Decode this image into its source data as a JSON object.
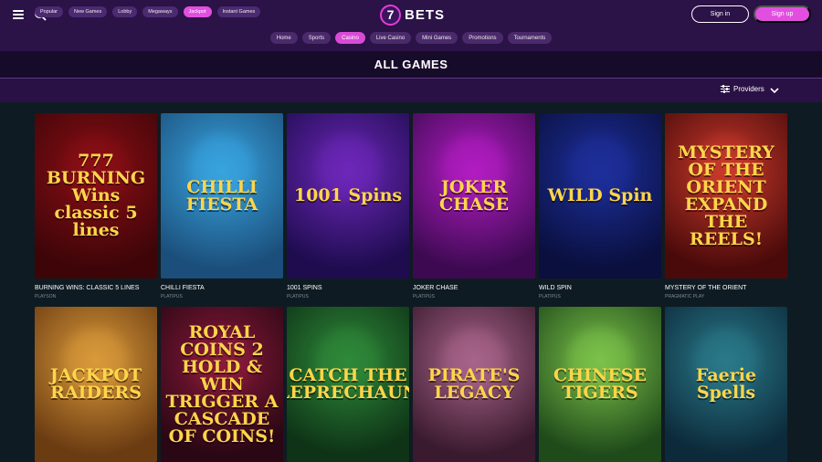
{
  "header": {
    "logo_number": "7",
    "logo_text": "BETS",
    "signin_label": "Sign in",
    "signup_label": "Sign up"
  },
  "nav": {
    "items": [
      "Home",
      "Sports",
      "Casino",
      "Live Casino",
      "Mini Games",
      "Promotions",
      "Tournaments"
    ],
    "active": "Casino"
  },
  "page_title": "ALL GAMES",
  "filters": {
    "items": [
      "Popular",
      "New Games",
      "Lobby",
      "Megaways",
      "Jackpot",
      "Instant Games"
    ],
    "active": "Jackpot",
    "providers_label": "Providers"
  },
  "games": [
    {
      "name": "BURNING WINS: CLASSIC 5 LINES",
      "provider": "PLAYSON",
      "thumb_text": "777 BURNING Wins classic 5 lines",
      "colors": [
        "#8b0f16",
        "#3d0508"
      ]
    },
    {
      "name": "CHILLI FIESTA",
      "provider": "PLATIPUS",
      "thumb_text": "CHILLI FIESTA",
      "colors": [
        "#38a4e0",
        "#1b4e7a"
      ]
    },
    {
      "name": "1001 SPINS",
      "provider": "PLATIPUS",
      "thumb_text": "1001 Spins",
      "colors": [
        "#6d27b9",
        "#1e0c4f"
      ]
    },
    {
      "name": "JOKER CHASE",
      "provider": "PLATIPUS",
      "thumb_text": "JOKER CHASE",
      "colors": [
        "#b21cc2",
        "#3d0a52"
      ]
    },
    {
      "name": "WILD SPIN",
      "provider": "PLATIPUS",
      "thumb_text": "WILD Spin",
      "colors": [
        "#1d2f9c",
        "#0a0f3d"
      ]
    },
    {
      "name": "MYSTERY OF THE ORIENT",
      "provider": "PRAGMATIC PLAY",
      "thumb_text": "MYSTERY OF THE ORIENT EXPAND THE REELS!",
      "colors": [
        "#c93a2c",
        "#4a0a0a"
      ]
    },
    {
      "name": "",
      "provider": "",
      "thumb_text": "JACKPOT RAIDERS",
      "colors": [
        "#d99a3a",
        "#6b3b12"
      ]
    },
    {
      "name": "",
      "provider": "",
      "thumb_text": "ROYAL COINS 2 HOLD & WIN TRIGGER A CASCADE OF COINS!",
      "colors": [
        "#8a1a3a",
        "#2a0714"
      ]
    },
    {
      "name": "",
      "provider": "",
      "thumb_text": "CATCH THE LEPRECHAUN",
      "colors": [
        "#2f8a3a",
        "#0e3316"
      ]
    },
    {
      "name": "",
      "provider": "",
      "thumb_text": "PIRATE'S LEGACY",
      "colors": [
        "#a8648a",
        "#3a1a2e"
      ]
    },
    {
      "name": "",
      "provider": "",
      "thumb_text": "CHINESE TIGERS",
      "colors": [
        "#7cc24a",
        "#1f4a1a"
      ]
    },
    {
      "name": "",
      "provider": "",
      "thumb_text": "Faerie Spells",
      "colors": [
        "#2a7a8a",
        "#0c2a3a"
      ]
    }
  ]
}
